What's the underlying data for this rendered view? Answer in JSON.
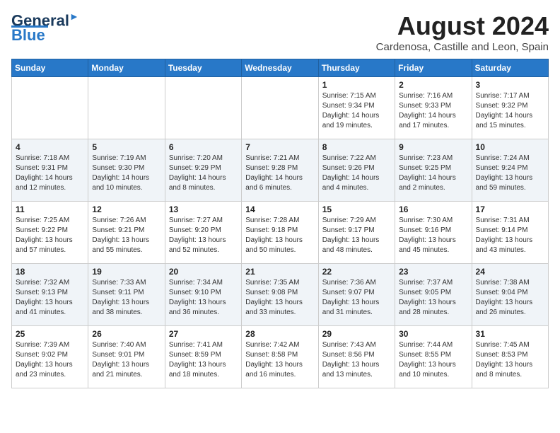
{
  "logo": {
    "line1": "General",
    "line2": "Blue"
  },
  "title": "August 2024",
  "subtitle": "Cardenosa, Castille and Leon, Spain",
  "days_of_week": [
    "Sunday",
    "Monday",
    "Tuesday",
    "Wednesday",
    "Thursday",
    "Friday",
    "Saturday"
  ],
  "weeks": [
    [
      {
        "day": "",
        "info": ""
      },
      {
        "day": "",
        "info": ""
      },
      {
        "day": "",
        "info": ""
      },
      {
        "day": "",
        "info": ""
      },
      {
        "day": "1",
        "info": "Sunrise: 7:15 AM\nSunset: 9:34 PM\nDaylight: 14 hours\nand 19 minutes."
      },
      {
        "day": "2",
        "info": "Sunrise: 7:16 AM\nSunset: 9:33 PM\nDaylight: 14 hours\nand 17 minutes."
      },
      {
        "day": "3",
        "info": "Sunrise: 7:17 AM\nSunset: 9:32 PM\nDaylight: 14 hours\nand 15 minutes."
      }
    ],
    [
      {
        "day": "4",
        "info": "Sunrise: 7:18 AM\nSunset: 9:31 PM\nDaylight: 14 hours\nand 12 minutes."
      },
      {
        "day": "5",
        "info": "Sunrise: 7:19 AM\nSunset: 9:30 PM\nDaylight: 14 hours\nand 10 minutes."
      },
      {
        "day": "6",
        "info": "Sunrise: 7:20 AM\nSunset: 9:29 PM\nDaylight: 14 hours\nand 8 minutes."
      },
      {
        "day": "7",
        "info": "Sunrise: 7:21 AM\nSunset: 9:28 PM\nDaylight: 14 hours\nand 6 minutes."
      },
      {
        "day": "8",
        "info": "Sunrise: 7:22 AM\nSunset: 9:26 PM\nDaylight: 14 hours\nand 4 minutes."
      },
      {
        "day": "9",
        "info": "Sunrise: 7:23 AM\nSunset: 9:25 PM\nDaylight: 14 hours\nand 2 minutes."
      },
      {
        "day": "10",
        "info": "Sunrise: 7:24 AM\nSunset: 9:24 PM\nDaylight: 13 hours\nand 59 minutes."
      }
    ],
    [
      {
        "day": "11",
        "info": "Sunrise: 7:25 AM\nSunset: 9:22 PM\nDaylight: 13 hours\nand 57 minutes."
      },
      {
        "day": "12",
        "info": "Sunrise: 7:26 AM\nSunset: 9:21 PM\nDaylight: 13 hours\nand 55 minutes."
      },
      {
        "day": "13",
        "info": "Sunrise: 7:27 AM\nSunset: 9:20 PM\nDaylight: 13 hours\nand 52 minutes."
      },
      {
        "day": "14",
        "info": "Sunrise: 7:28 AM\nSunset: 9:18 PM\nDaylight: 13 hours\nand 50 minutes."
      },
      {
        "day": "15",
        "info": "Sunrise: 7:29 AM\nSunset: 9:17 PM\nDaylight: 13 hours\nand 48 minutes."
      },
      {
        "day": "16",
        "info": "Sunrise: 7:30 AM\nSunset: 9:16 PM\nDaylight: 13 hours\nand 45 minutes."
      },
      {
        "day": "17",
        "info": "Sunrise: 7:31 AM\nSunset: 9:14 PM\nDaylight: 13 hours\nand 43 minutes."
      }
    ],
    [
      {
        "day": "18",
        "info": "Sunrise: 7:32 AM\nSunset: 9:13 PM\nDaylight: 13 hours\nand 41 minutes."
      },
      {
        "day": "19",
        "info": "Sunrise: 7:33 AM\nSunset: 9:11 PM\nDaylight: 13 hours\nand 38 minutes."
      },
      {
        "day": "20",
        "info": "Sunrise: 7:34 AM\nSunset: 9:10 PM\nDaylight: 13 hours\nand 36 minutes."
      },
      {
        "day": "21",
        "info": "Sunrise: 7:35 AM\nSunset: 9:08 PM\nDaylight: 13 hours\nand 33 minutes."
      },
      {
        "day": "22",
        "info": "Sunrise: 7:36 AM\nSunset: 9:07 PM\nDaylight: 13 hours\nand 31 minutes."
      },
      {
        "day": "23",
        "info": "Sunrise: 7:37 AM\nSunset: 9:05 PM\nDaylight: 13 hours\nand 28 minutes."
      },
      {
        "day": "24",
        "info": "Sunrise: 7:38 AM\nSunset: 9:04 PM\nDaylight: 13 hours\nand 26 minutes."
      }
    ],
    [
      {
        "day": "25",
        "info": "Sunrise: 7:39 AM\nSunset: 9:02 PM\nDaylight: 13 hours\nand 23 minutes."
      },
      {
        "day": "26",
        "info": "Sunrise: 7:40 AM\nSunset: 9:01 PM\nDaylight: 13 hours\nand 21 minutes."
      },
      {
        "day": "27",
        "info": "Sunrise: 7:41 AM\nSunset: 8:59 PM\nDaylight: 13 hours\nand 18 minutes."
      },
      {
        "day": "28",
        "info": "Sunrise: 7:42 AM\nSunset: 8:58 PM\nDaylight: 13 hours\nand 16 minutes."
      },
      {
        "day": "29",
        "info": "Sunrise: 7:43 AM\nSunset: 8:56 PM\nDaylight: 13 hours\nand 13 minutes."
      },
      {
        "day": "30",
        "info": "Sunrise: 7:44 AM\nSunset: 8:55 PM\nDaylight: 13 hours\nand 10 minutes."
      },
      {
        "day": "31",
        "info": "Sunrise: 7:45 AM\nSunset: 8:53 PM\nDaylight: 13 hours\nand 8 minutes."
      }
    ]
  ]
}
